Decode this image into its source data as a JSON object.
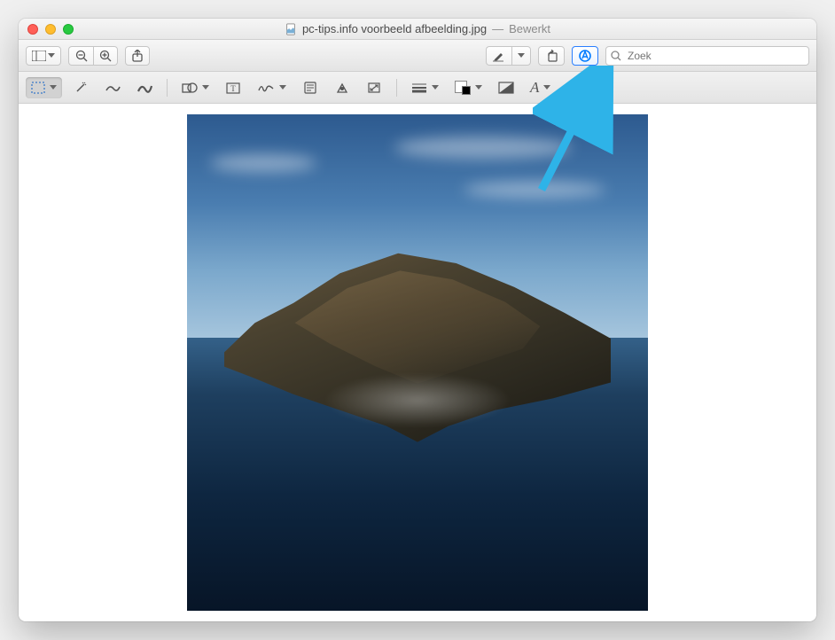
{
  "titlebar": {
    "filename": "pc-tips.info voorbeeld afbeelding.jpg",
    "status_sep": "—",
    "status": "Bewerkt"
  },
  "toolbar": {
    "search_placeholder": "Zoek"
  },
  "colors": {
    "accent": "#007aff",
    "arrow": "#2eb3e8"
  }
}
